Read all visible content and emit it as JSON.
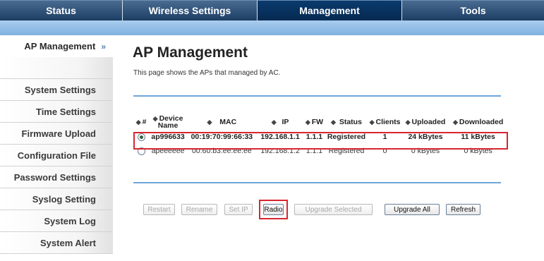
{
  "topnav": {
    "tabs": [
      "Status",
      "Wireless Settings",
      "Management",
      "Tools"
    ],
    "active": "Management"
  },
  "sidebar": {
    "items": [
      "AP Management",
      "",
      "System Settings",
      "Time Settings",
      "Firmware Upload",
      "Configuration File",
      "Password Settings",
      "Syslog Setting",
      "System Log",
      "System Alert"
    ],
    "active_arrow": "»"
  },
  "main": {
    "title": "AP Management",
    "description": "This page shows the APs that managed by AC."
  },
  "table": {
    "headers": [
      "#",
      "Device Name",
      "MAC",
      "IP",
      "FW",
      "Status",
      "Clients",
      "Uploaded",
      "Downloaded"
    ],
    "header_hash": "#",
    "device_name_line1": "Device",
    "device_name_line2": "Name",
    "sort_glyph": "◆",
    "rows": [
      {
        "selected": true,
        "device_name": "ap996633",
        "mac": "00:19:70:99:66:33",
        "ip": "192.168.1.1",
        "fw": "1.1.1",
        "status": "Registered",
        "clients": "1",
        "uploaded": "24 kBytes",
        "downloaded": "11 kBytes"
      },
      {
        "selected": false,
        "device_name": "apeeeeee",
        "mac": "00:60:b3:ee:ee:ee",
        "ip": "192.168.1.2",
        "fw": "1.1.1",
        "status": "Registered",
        "clients": "0",
        "uploaded": "0 kBytes",
        "downloaded": "0 kBytes"
      }
    ]
  },
  "buttons": {
    "restart": "Restart",
    "rename": "Rename",
    "set_ip": "Set IP",
    "radio": "Radio",
    "upgrade_selected": "Upgrade Selected",
    "upgrade_all": "Upgrade All",
    "refresh": "Refresh"
  },
  "colors": {
    "nav_dark": "#1f4066",
    "nav_active": "#062a52",
    "subbar": "#8fbde6",
    "divider": "#6fa6d9",
    "highlight": "#d9262e"
  }
}
